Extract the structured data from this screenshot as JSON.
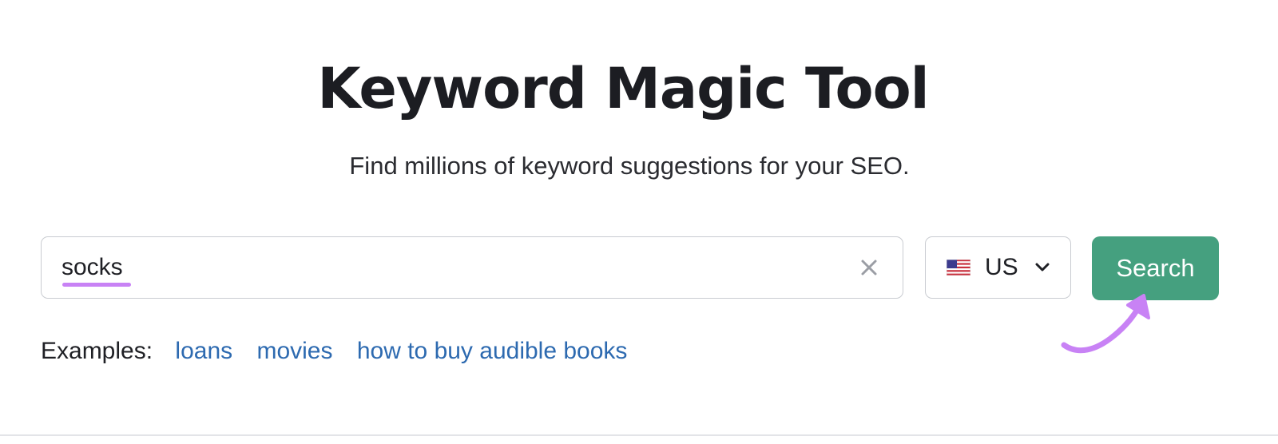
{
  "header": {
    "title": "Keyword Magic Tool",
    "subtitle": "Find millions of keyword suggestions for your SEO."
  },
  "search": {
    "value": "socks",
    "clear_icon": "close-icon"
  },
  "database": {
    "flag_icon": "us-flag-icon",
    "label": "US",
    "chevron_icon": "chevron-down-icon"
  },
  "search_button": {
    "label": "Search",
    "color": "#45a07f"
  },
  "examples": {
    "label": "Examples:",
    "links": [
      "loans",
      "movies",
      "how to buy audible books"
    ],
    "link_color": "#2d6ab0"
  },
  "annotation": {
    "highlight_color": "#c882f5",
    "arrow_icon": "curved-arrow-icon"
  }
}
